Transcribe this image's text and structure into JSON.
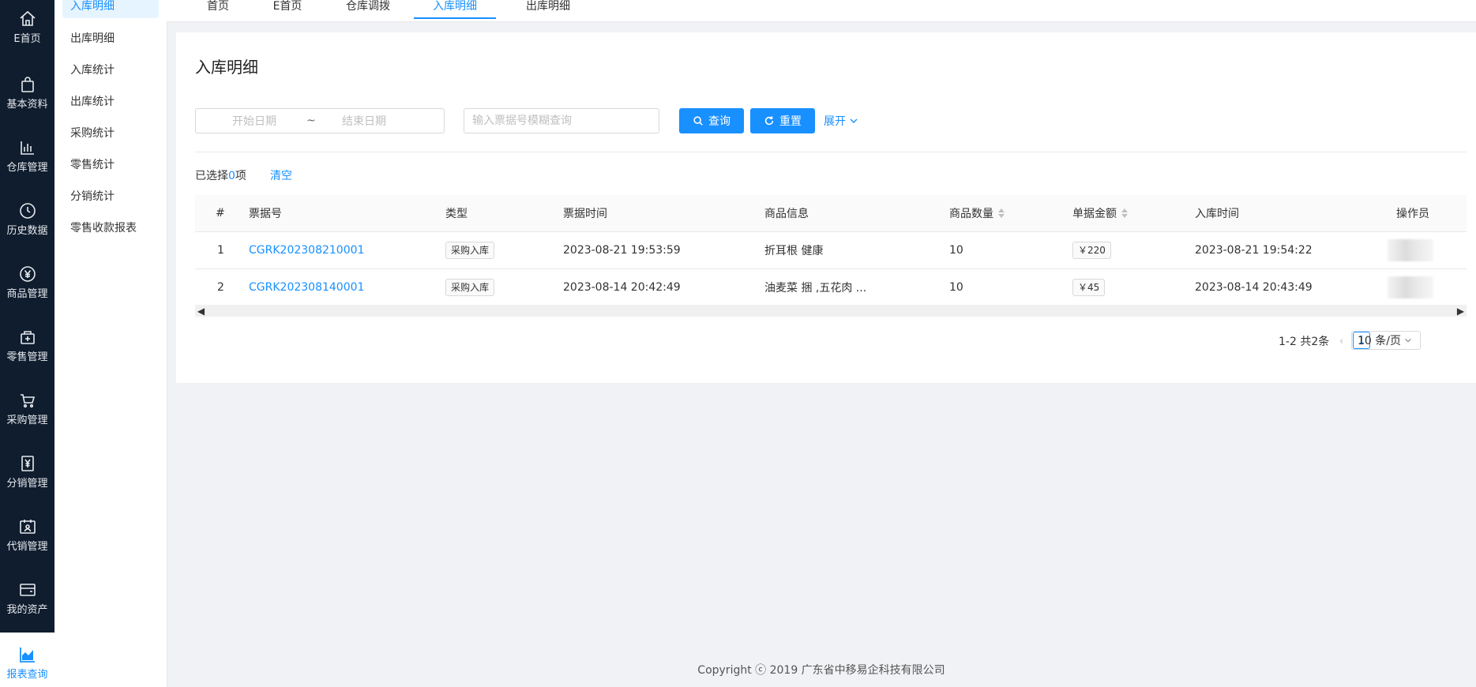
{
  "sidebar": {
    "items": [
      {
        "label": "E首页",
        "icon": "home-icon"
      },
      {
        "label": "基本资料",
        "icon": "bag-icon"
      },
      {
        "label": "仓库管理",
        "icon": "bar-chart-icon"
      },
      {
        "label": "历史数据",
        "icon": "clock-icon"
      },
      {
        "label": "商品管理",
        "icon": "yen-circle-icon"
      },
      {
        "label": "零售管理",
        "icon": "box-plus-icon"
      },
      {
        "label": "采购管理",
        "icon": "cart-icon"
      },
      {
        "label": "分销管理",
        "icon": "yen-doc-icon"
      },
      {
        "label": "代销管理",
        "icon": "calendar-person-icon"
      },
      {
        "label": "我的资产",
        "icon": "wallet-icon"
      },
      {
        "label": "报表查询",
        "icon": "area-chart-icon"
      }
    ]
  },
  "submenu": {
    "items": [
      "入库明细",
      "出库明细",
      "入库统计",
      "出库统计",
      "采购统计",
      "零售统计",
      "分销统计",
      "零售收款报表"
    ]
  },
  "tabs": [
    "首页",
    "E首页",
    "仓库调拨",
    "入库明细",
    "出库明细"
  ],
  "page": {
    "title": "入库明细"
  },
  "filters": {
    "start_placeholder": "开始日期",
    "end_placeholder": "结束日期",
    "separator": "~",
    "search_placeholder": "输入票据号模糊查询",
    "search_button": "查询",
    "reset_button": "重置",
    "expand_label": "展开"
  },
  "selection": {
    "prefix": "已选择",
    "count": "0",
    "suffix": "项",
    "clear_label": "清空"
  },
  "table": {
    "columns": [
      "#",
      "票据号",
      "类型",
      "票据时间",
      "商品信息",
      "商品数量",
      "单据金额",
      "入库时间",
      "操作员"
    ],
    "rows": [
      {
        "index": "1",
        "bill_no": "CGRK202308210001",
        "type": "采购入库",
        "bill_time": "2023-08-21 19:53:59",
        "goods": "折耳根 健康",
        "qty": "10",
        "amount": "￥220",
        "in_time": "2023-08-21 19:54:22"
      },
      {
        "index": "2",
        "bill_no": "CGRK202308140001",
        "type": "采购入库",
        "bill_time": "2023-08-14 20:42:49",
        "goods": "油麦菜 捆 ,五花肉 ...",
        "qty": "10",
        "amount": "￥45",
        "in_time": "2023-08-14 20:43:49"
      }
    ]
  },
  "pagination": {
    "summary": "1-2 共2条",
    "current": "1",
    "page_size": "10 条/页"
  },
  "footer": {
    "copyright": "Copyright ⓒ 2019 广东省中移易企科技有限公司"
  },
  "colors": {
    "accent": "#1890ff",
    "sidebar_bg": "#0f1d2e"
  }
}
